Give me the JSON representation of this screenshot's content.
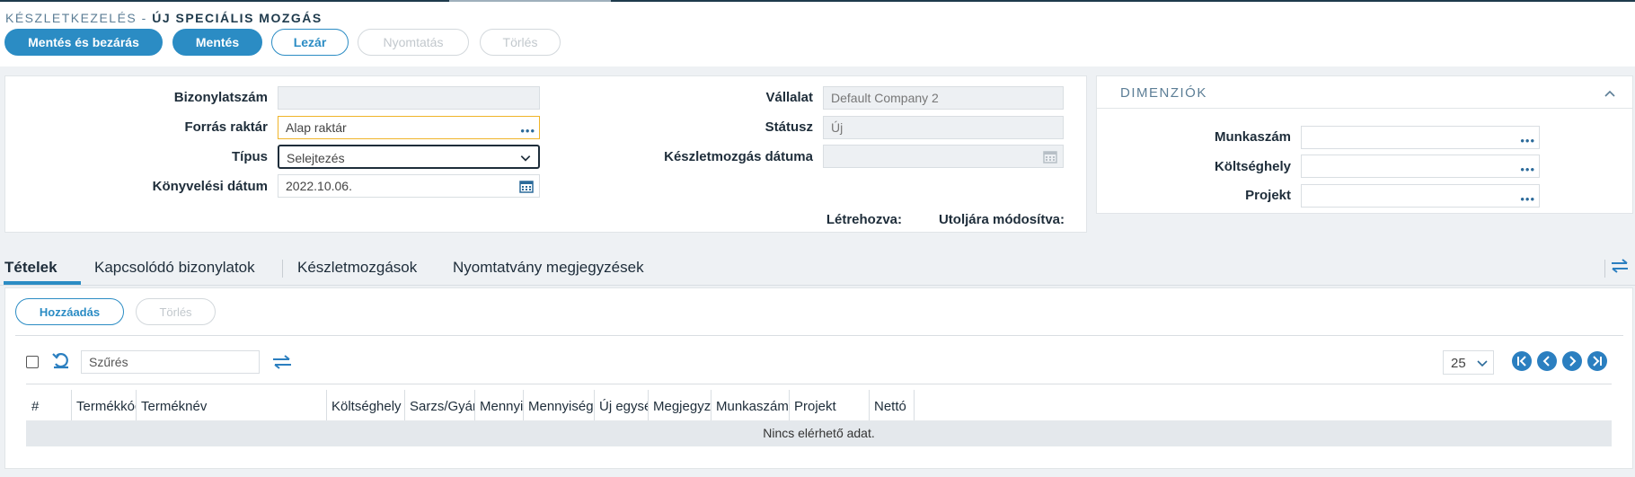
{
  "header": {
    "breadcrumb": "KÉSZLETKEZELÉS -",
    "title": "ÚJ SPECIÁLIS MOZGÁS"
  },
  "toolbar": {
    "save_close": "Mentés és bezárás",
    "save": "Mentés",
    "close": "Lezár",
    "print": "Nyomtatás",
    "delete": "Törlés"
  },
  "form": {
    "doc_number_label": "Bizonylatszám",
    "doc_number_value": "",
    "source_wh_label": "Forrás raktár",
    "source_wh_value": "Alap raktár",
    "type_label": "Típus",
    "type_value": "Selejtezés",
    "posting_date_label": "Könyvelési dátum",
    "posting_date_value": "2022.10.06.",
    "company_label": "Vállalat",
    "company_value": "Default Company 2",
    "status_label": "Státusz",
    "status_value": "Új",
    "movement_date_label": "Készletmozgás dátuma",
    "movement_date_value": "",
    "created_label": "Létrehozva:",
    "modified_label": "Utoljára módosítva:"
  },
  "dimensions": {
    "title": "DIMENZIÓK",
    "job_label": "Munkaszám",
    "cost_center_label": "Költséghely",
    "project_label": "Projekt"
  },
  "tabs": [
    {
      "label": "Tételek"
    },
    {
      "label": "Kapcsolódó bizonylatok"
    },
    {
      "label": "Készletmozgások"
    },
    {
      "label": "Nyomtatvány megjegyzések"
    }
  ],
  "items": {
    "add": "Hozzáadás",
    "delete": "Törlés",
    "filter_placeholder": "Szűrés",
    "page_size": "25",
    "columns": [
      "#",
      "Termékkód",
      "Terméknév",
      "Költséghely",
      "Sarzs/Gyártási szám",
      "Mennyiség",
      "Mennyiségi egység",
      "Új egységár",
      "Megjegyzés",
      "Munkaszám",
      "Projekt",
      "Nettó"
    ],
    "empty": "Nincs elérhető adat."
  },
  "colors": {
    "primary": "#2b8cc4",
    "dark": "#1e3a4c"
  }
}
